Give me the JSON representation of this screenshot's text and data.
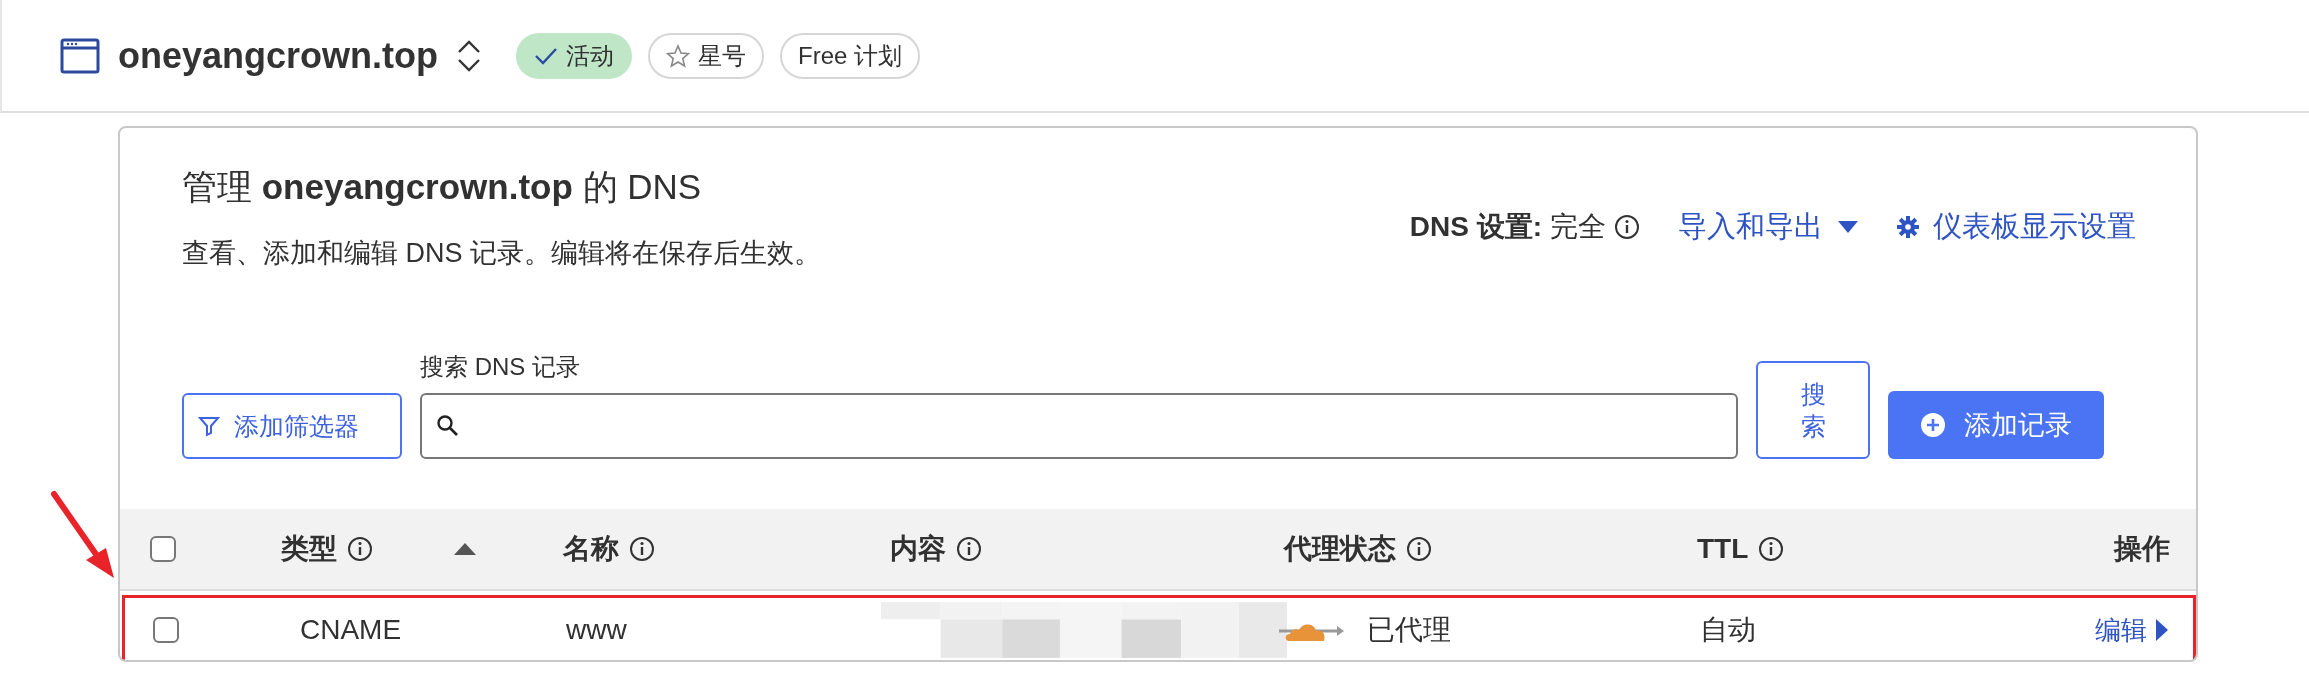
{
  "zone": {
    "domain": "oneyangcrown.top",
    "badges": [
      {
        "kind": "status",
        "label": "活动"
      },
      {
        "kind": "star",
        "label": "星号"
      },
      {
        "kind": "plan",
        "label": "Free 计划"
      }
    ]
  },
  "dns_panel": {
    "title": "管理 **oneyangcrown.top** 的 DNS",
    "subtitle": "查看、添加和编辑 DNS 记录。编辑将在保存后生效。",
    "setting_label": "DNS 设置:",
    "setting_value": "完全",
    "import_export": "导入和导出",
    "dashboard_settings": "仪表板显示设置",
    "search_label": "搜索 DNS 记录",
    "filter_button": "添加筛选器",
    "search_button": "搜索",
    "add_button": "添加记录"
  },
  "table": {
    "header_checked": false,
    "columns": [
      {
        "label": "类型",
        "info": true,
        "sorted": true
      },
      {
        "label": "名称",
        "info": true,
        "sorted": false
      },
      {
        "label": "内容",
        "info": true,
        "sorted": false
      },
      {
        "label": "代理状态",
        "info": true,
        "sorted": false
      },
      {
        "label": "TTL",
        "info": true,
        "sorted": false
      },
      {
        "label": "操作",
        "info": false,
        "sorted": false
      }
    ],
    "rows": [
      {
        "checked": false,
        "highlighted": true,
        "type": "CNAME",
        "name": "www",
        "proxy_status": "已代理",
        "proxied": true,
        "ttl": "自动",
        "action": "编辑"
      }
    ]
  }
}
